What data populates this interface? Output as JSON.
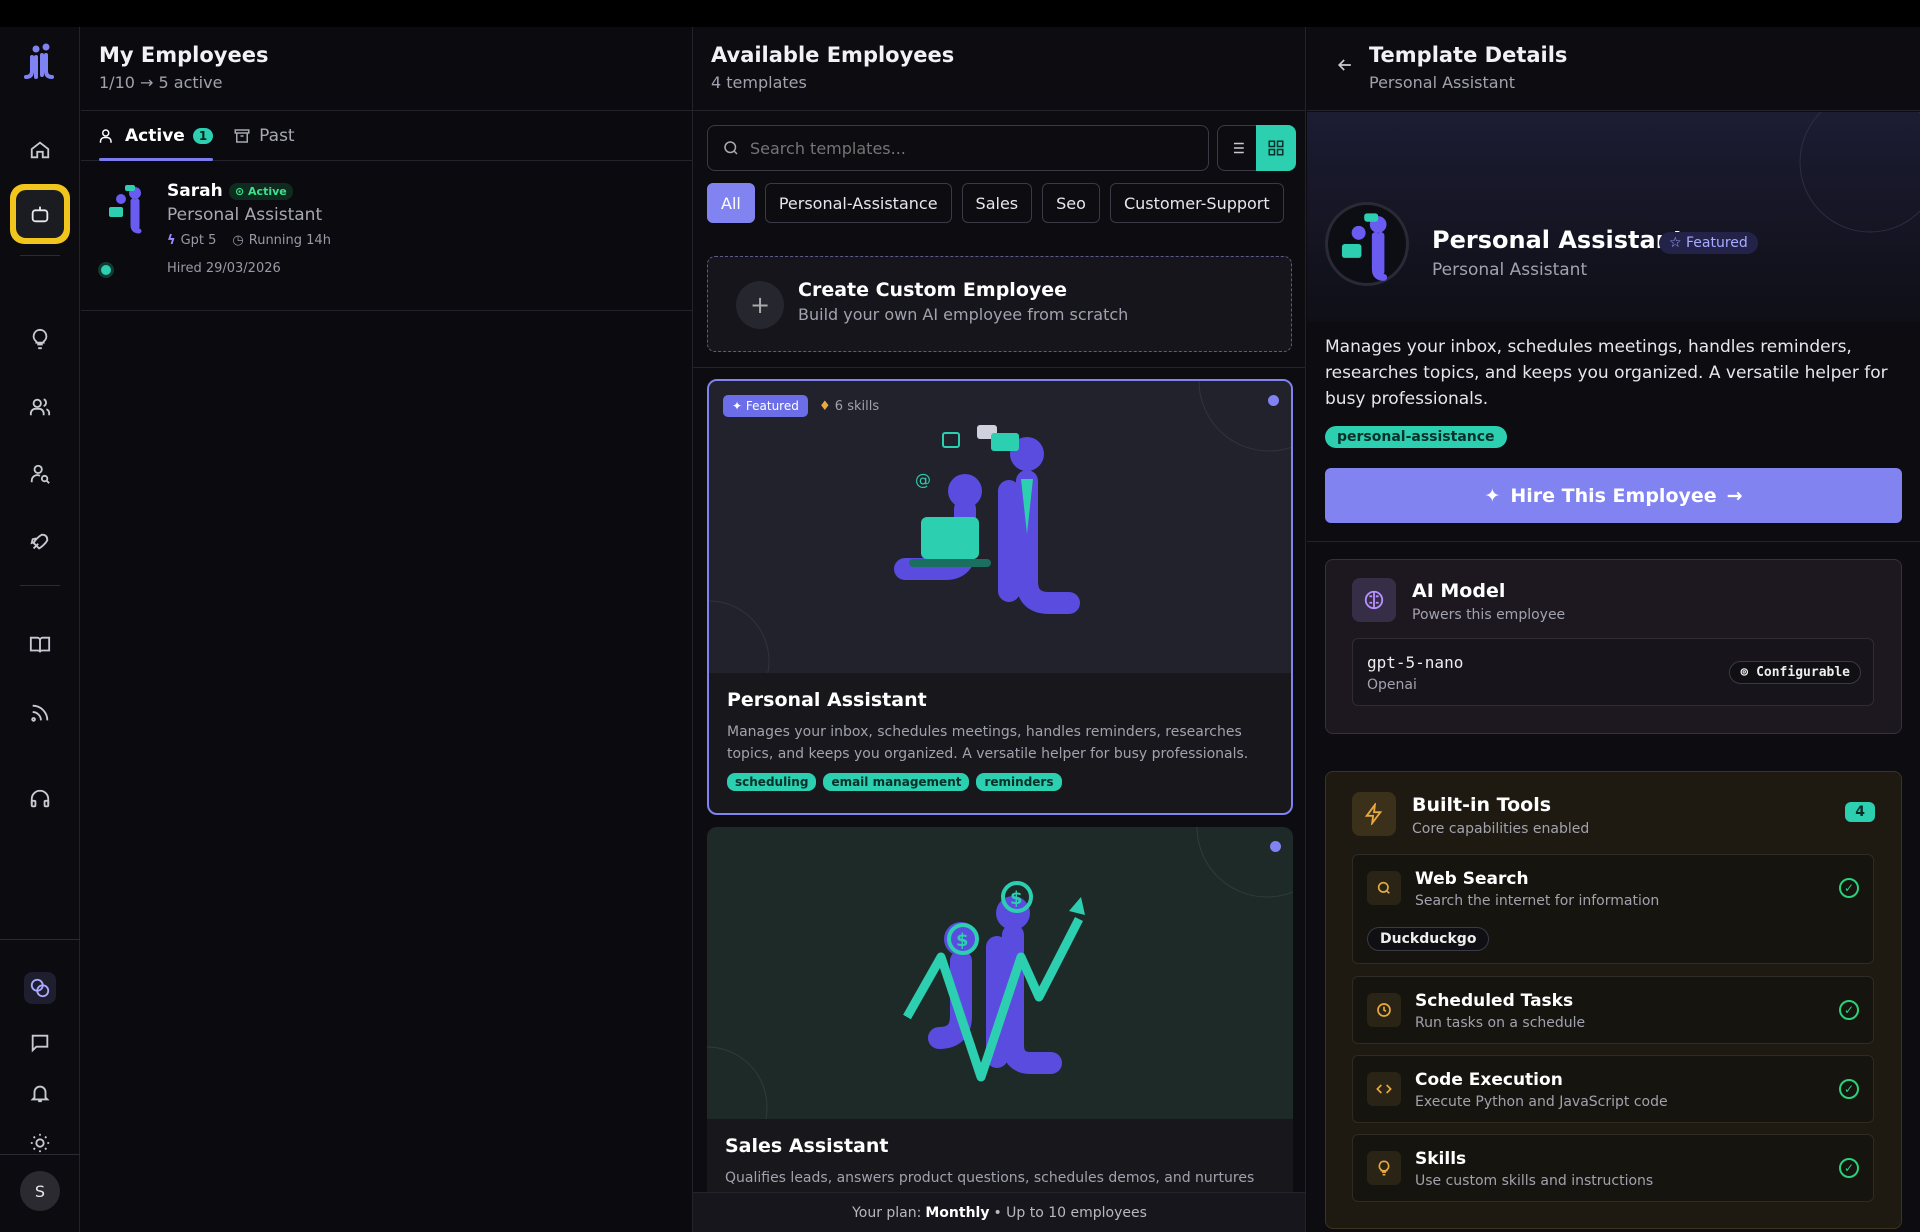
{
  "brand": {
    "accent": "#8083f0",
    "teal": "#2ccfb0",
    "highlight": "#f2c51d"
  },
  "rail": {
    "items": [
      "home-icon",
      "bot-icon",
      "lightbulb-icon",
      "users-icon",
      "user-search-icon",
      "rocket-icon",
      "book-icon",
      "rss-icon",
      "headphones-icon",
      "connections-icon",
      "chat-icon",
      "bell-icon",
      "sun-icon"
    ],
    "avatar": "S"
  },
  "my_employees": {
    "title": "My Employees",
    "subtitle": "1/10 → 5 active",
    "tabs": [
      {
        "label": "Active",
        "count": "1"
      },
      {
        "label": "Past"
      }
    ],
    "items": [
      {
        "name": "Sarah",
        "status": "Active",
        "role": "Personal Assistant",
        "model": "Gpt 5",
        "uptime": "Running 14h",
        "hired": "Hired 29/03/2026"
      }
    ]
  },
  "available": {
    "title": "Available Employees",
    "subtitle": "4 templates",
    "search_placeholder": "Search templates...",
    "filters": [
      "All",
      "Personal-Assistance",
      "Sales",
      "Seo",
      "Customer-Support"
    ],
    "create": {
      "title": "Create Custom Employee",
      "desc": "Build your own AI employee from scratch"
    },
    "cards": [
      {
        "featured": "Featured",
        "skills": "6 skills",
        "title": "Personal Assistant",
        "desc": "Manages your inbox, schedules meetings, handles reminders, researches topics, and keeps you organized. A versatile helper for busy professionals.",
        "tags": [
          "scheduling",
          "email management",
          "reminders"
        ]
      },
      {
        "title": "Sales Assistant",
        "desc": "Qualifies leads, answers product questions, schedules demos, and nurtures"
      }
    ],
    "plan": {
      "prefix": "Your plan:",
      "name": "Monthly",
      "suffix": "• Up to 10 employees"
    }
  },
  "details": {
    "title": "Template Details",
    "subtitle": "Personal Assistant",
    "name": "Personal Assistant",
    "featured": "Featured",
    "role": "Personal Assistant",
    "description": "Manages your inbox, schedules meetings, handles reminders, researches topics, and keeps you organized. A versatile helper for busy professionals.",
    "category": "personal-assistance",
    "hire": "Hire This Employee",
    "ai_model": {
      "title": "AI Model",
      "subtitle": "Powers this employee",
      "model": "gpt-5-nano",
      "provider": "Openai",
      "badge": "Configurable"
    },
    "tools": {
      "title": "Built-in Tools",
      "subtitle": "Core capabilities enabled",
      "count": "4",
      "items": [
        {
          "name": "Web Search",
          "desc": "Search the internet for information",
          "provider": "Duckduckgo"
        },
        {
          "name": "Scheduled Tasks",
          "desc": "Run tasks on a schedule"
        },
        {
          "name": "Code Execution",
          "desc": "Execute Python and JavaScript code"
        },
        {
          "name": "Skills",
          "desc": "Use custom skills and instructions"
        }
      ]
    }
  }
}
